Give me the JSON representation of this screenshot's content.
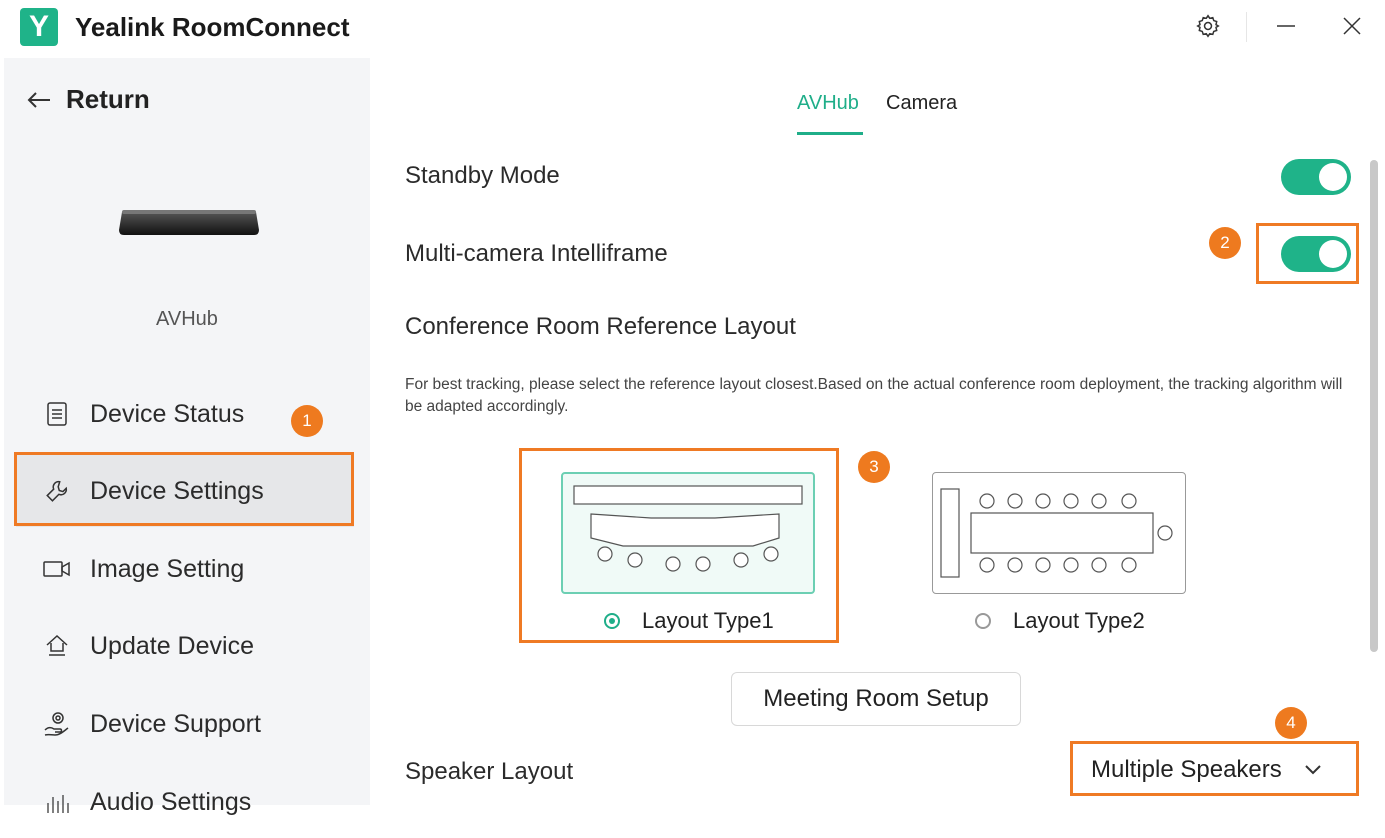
{
  "app": {
    "logo_letter": "Y",
    "title": "Yealink RoomConnect"
  },
  "sidebar": {
    "return_label": "Return",
    "device_name": "AVHub",
    "items": [
      {
        "label": "Device Status",
        "icon": "document-icon"
      },
      {
        "label": "Device Settings",
        "icon": "wrench-icon",
        "active": true
      },
      {
        "label": "Image Setting",
        "icon": "video-camera-icon"
      },
      {
        "label": "Update Device",
        "icon": "upload-icon"
      },
      {
        "label": "Device Support",
        "icon": "support-icon"
      },
      {
        "label": "Audio Settings",
        "icon": "audio-bars-icon"
      }
    ]
  },
  "tabs": [
    {
      "label": "AVHub",
      "active": true
    },
    {
      "label": "Camera",
      "active": false
    }
  ],
  "settings": {
    "standby_mode": {
      "label": "Standby Mode",
      "on": true
    },
    "intelliframe": {
      "label": "Multi-camera Intelliframe",
      "on": true
    },
    "layout_heading": "Conference Room Reference Layout",
    "layout_desc": "For best tracking, please select the reference layout closest.Based on the actual conference room deployment, the tracking algorithm will be adapted accordingly.",
    "layouts": [
      {
        "label": "Layout Type1",
        "selected": true
      },
      {
        "label": "Layout Type2",
        "selected": false
      }
    ],
    "setup_button": "Meeting Room Setup",
    "speaker_layout": {
      "label": "Speaker Layout",
      "value": "Multiple Speakers"
    }
  },
  "annotations": [
    "1",
    "2",
    "3",
    "4"
  ],
  "colors": {
    "accent": "#1fae89",
    "highlight": "#ef7a24"
  }
}
